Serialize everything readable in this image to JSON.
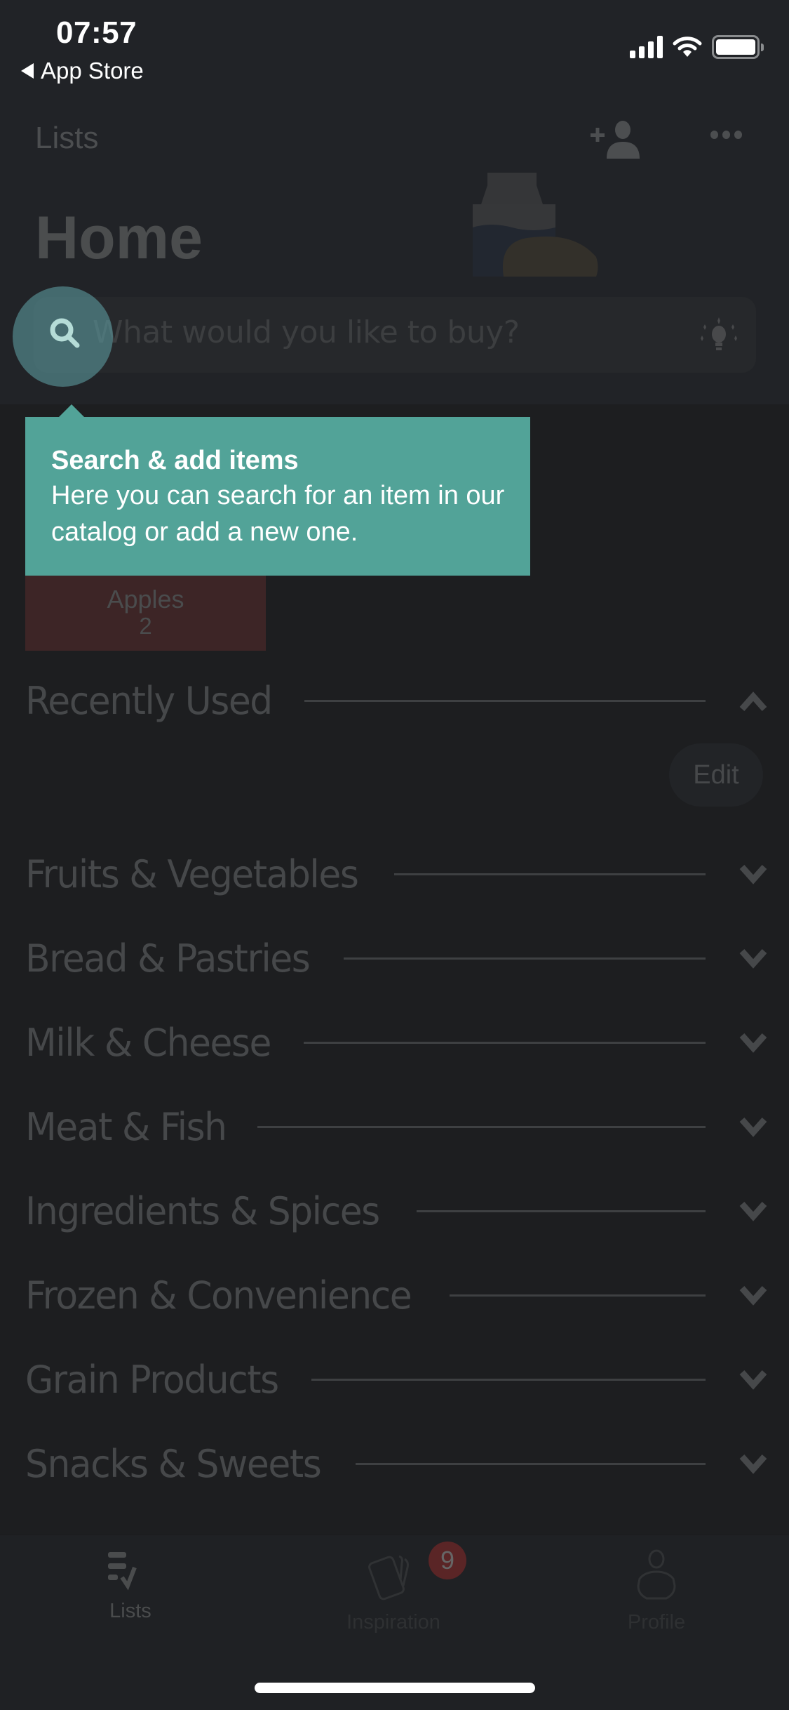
{
  "status_bar": {
    "time": "07:57",
    "back_app": "App Store",
    "icons": [
      "cellular-signal-icon",
      "wifi-icon",
      "battery-icon"
    ]
  },
  "nav": {
    "back_label": "Lists",
    "actions": [
      "add-person-icon",
      "more-icon"
    ]
  },
  "list": {
    "title": "Home",
    "illustration": "milk-and-bread-illustration"
  },
  "search": {
    "placeholder": "What would you like to buy?",
    "left_icon": "search-icon",
    "right_icon": "lightbulb-icon"
  },
  "tooltip": {
    "title": "Search & add items",
    "body": "Here you can search for an item in our catalog or add a new one."
  },
  "items": [
    {
      "name": "Apples",
      "quantity": "2"
    }
  ],
  "recently_used": {
    "label": "Recently Used",
    "expanded": true,
    "edit_label": "Edit"
  },
  "categories": [
    {
      "label": "Fruits & Vegetables"
    },
    {
      "label": "Bread & Pastries"
    },
    {
      "label": "Milk & Cheese"
    },
    {
      "label": "Meat & Fish"
    },
    {
      "label": "Ingredients & Spices"
    },
    {
      "label": "Frozen & Convenience"
    },
    {
      "label": "Grain Products"
    },
    {
      "label": "Snacks & Sweets"
    }
  ],
  "tabbar": {
    "tabs": [
      {
        "label": "Lists",
        "icon": "lists-icon",
        "active": true
      },
      {
        "label": "Inspiration",
        "icon": "cards-icon",
        "badge": "9"
      },
      {
        "label": "Profile",
        "icon": "person-icon"
      }
    ]
  },
  "colors": {
    "tooltip_bg": "#52a398",
    "spotlight": "#5a969b",
    "item_tile_bg": "#3d2526",
    "badge_bg": "#5a2526",
    "background": "#1d1e20"
  }
}
